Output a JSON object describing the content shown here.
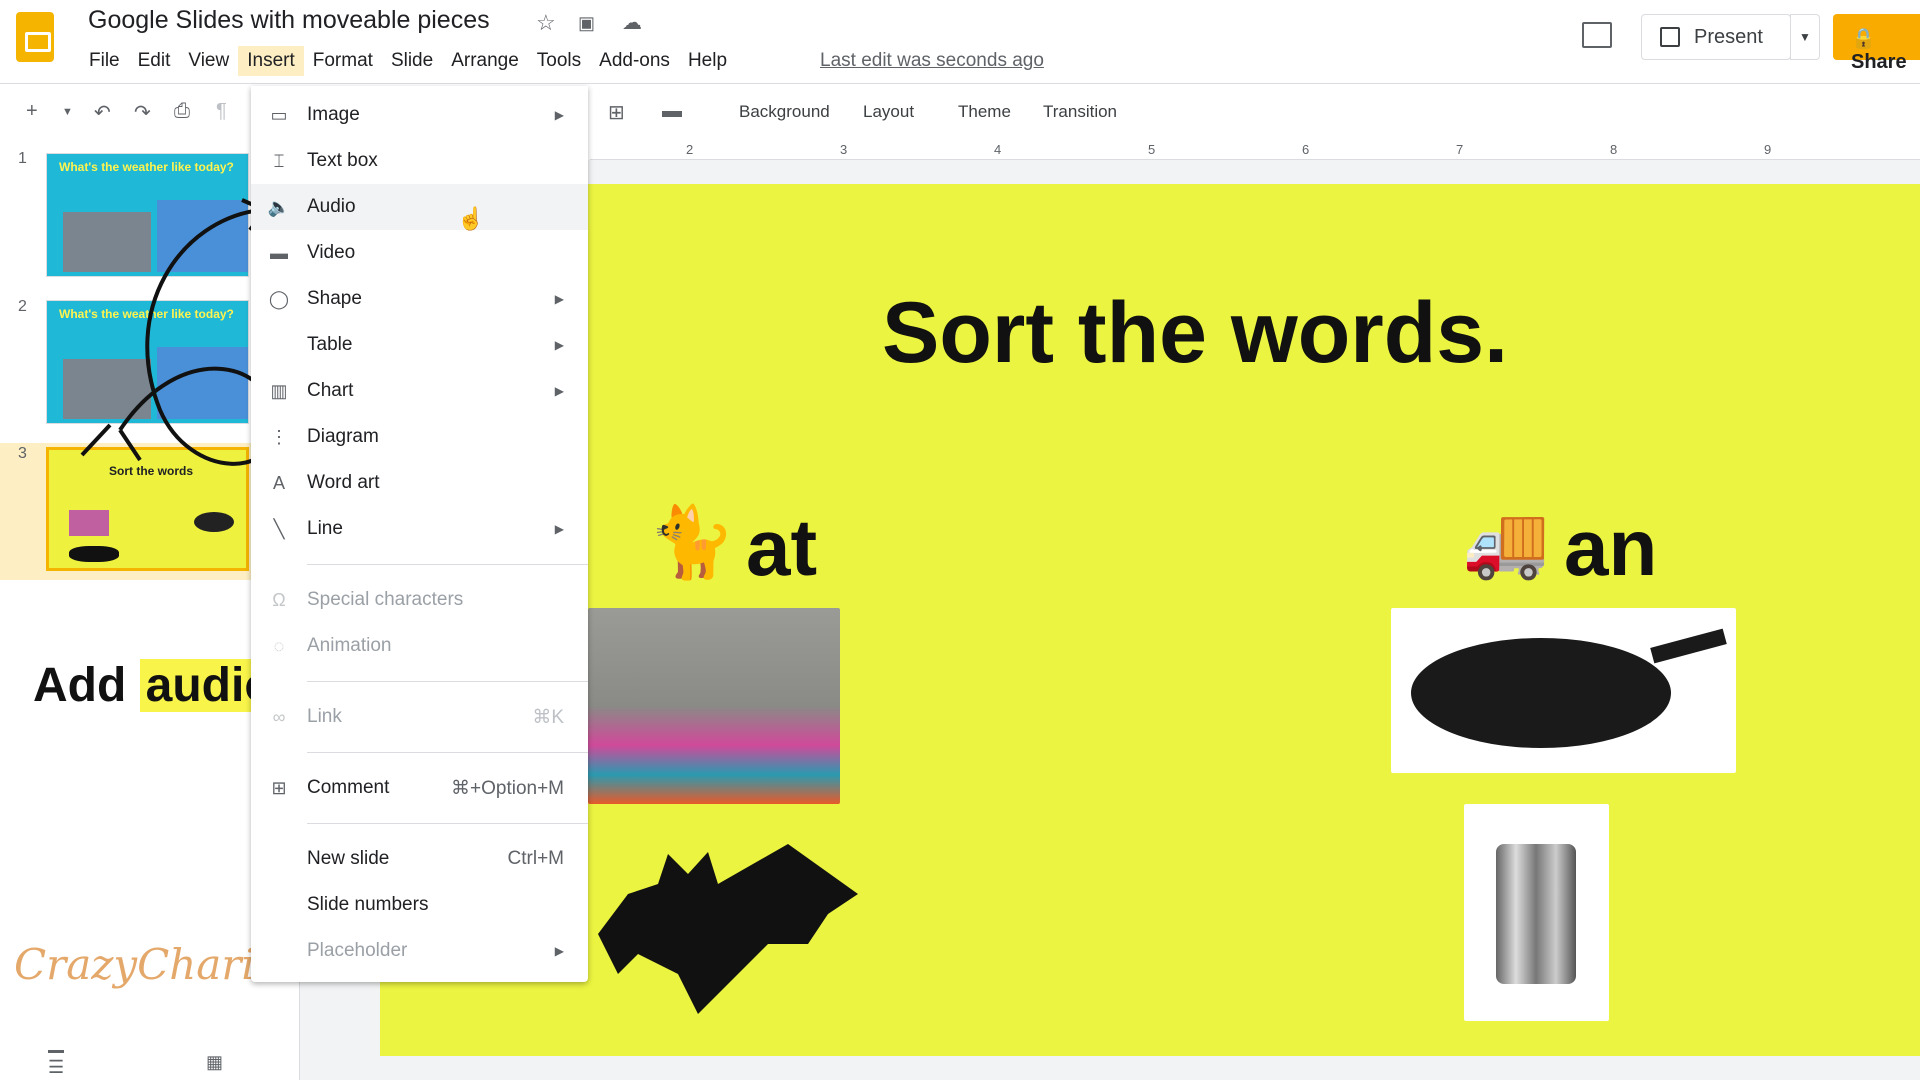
{
  "app": {
    "title": "Google Slides with moveable pieces",
    "last_edit": "Last edit was seconds ago",
    "present_label": "Present",
    "share_label": "Share"
  },
  "menubar": [
    "File",
    "Edit",
    "View",
    "Insert",
    "Format",
    "Slide",
    "Arrange",
    "Tools",
    "Add-ons",
    "Help"
  ],
  "toolbar": {
    "background": "Background",
    "layout": "Layout",
    "theme": "Theme",
    "transition": "Transition"
  },
  "ruler": [
    "2",
    "3",
    "4",
    "5",
    "6",
    "7",
    "8",
    "9"
  ],
  "slides": [
    {
      "num": "1",
      "title": "What's the weather like today?"
    },
    {
      "num": "2",
      "title": "What's the weather like today?"
    },
    {
      "num": "3",
      "title": "Sort the words"
    }
  ],
  "insert_menu": [
    {
      "label": "Image",
      "icon": "image-icon",
      "submenu": true
    },
    {
      "label": "Text box",
      "icon": "textbox-icon"
    },
    {
      "label": "Audio",
      "icon": "audio-icon",
      "hover": true
    },
    {
      "label": "Video",
      "icon": "video-icon"
    },
    {
      "label": "Shape",
      "icon": "shape-icon",
      "submenu": true
    },
    {
      "label": "Table",
      "submenu": true
    },
    {
      "label": "Chart",
      "icon": "chart-icon",
      "submenu": true
    },
    {
      "label": "Diagram",
      "icon": "diagram-icon"
    },
    {
      "label": "Word art",
      "icon": "wordart-icon"
    },
    {
      "label": "Line",
      "icon": "line-icon",
      "submenu": true
    },
    {
      "label": "Special characters",
      "icon": "omega-icon",
      "disabled": true
    },
    {
      "label": "Animation",
      "icon": "animation-icon",
      "disabled": true
    },
    {
      "label": "Link",
      "icon": "link-icon",
      "shortcut": "⌘K",
      "disabled": true
    },
    {
      "label": "Comment",
      "icon": "comment-icon",
      "shortcut": "⌘+Option+M"
    },
    {
      "label": "New slide",
      "shortcut": "Ctrl+M"
    },
    {
      "label": "Slide numbers"
    },
    {
      "label": "Placeholder",
      "submenu": true,
      "disabled": true
    }
  ],
  "slide": {
    "title": "Sort the words.",
    "word1": "at",
    "word2": "an"
  },
  "overlay": {
    "add": "Add",
    "audio": "audio",
    "watermark": "CrazyCharizma"
  },
  "colors": {
    "slide_bg": "#ebf440",
    "accent": "#f9ab00",
    "highlight": "#f8f44a"
  }
}
